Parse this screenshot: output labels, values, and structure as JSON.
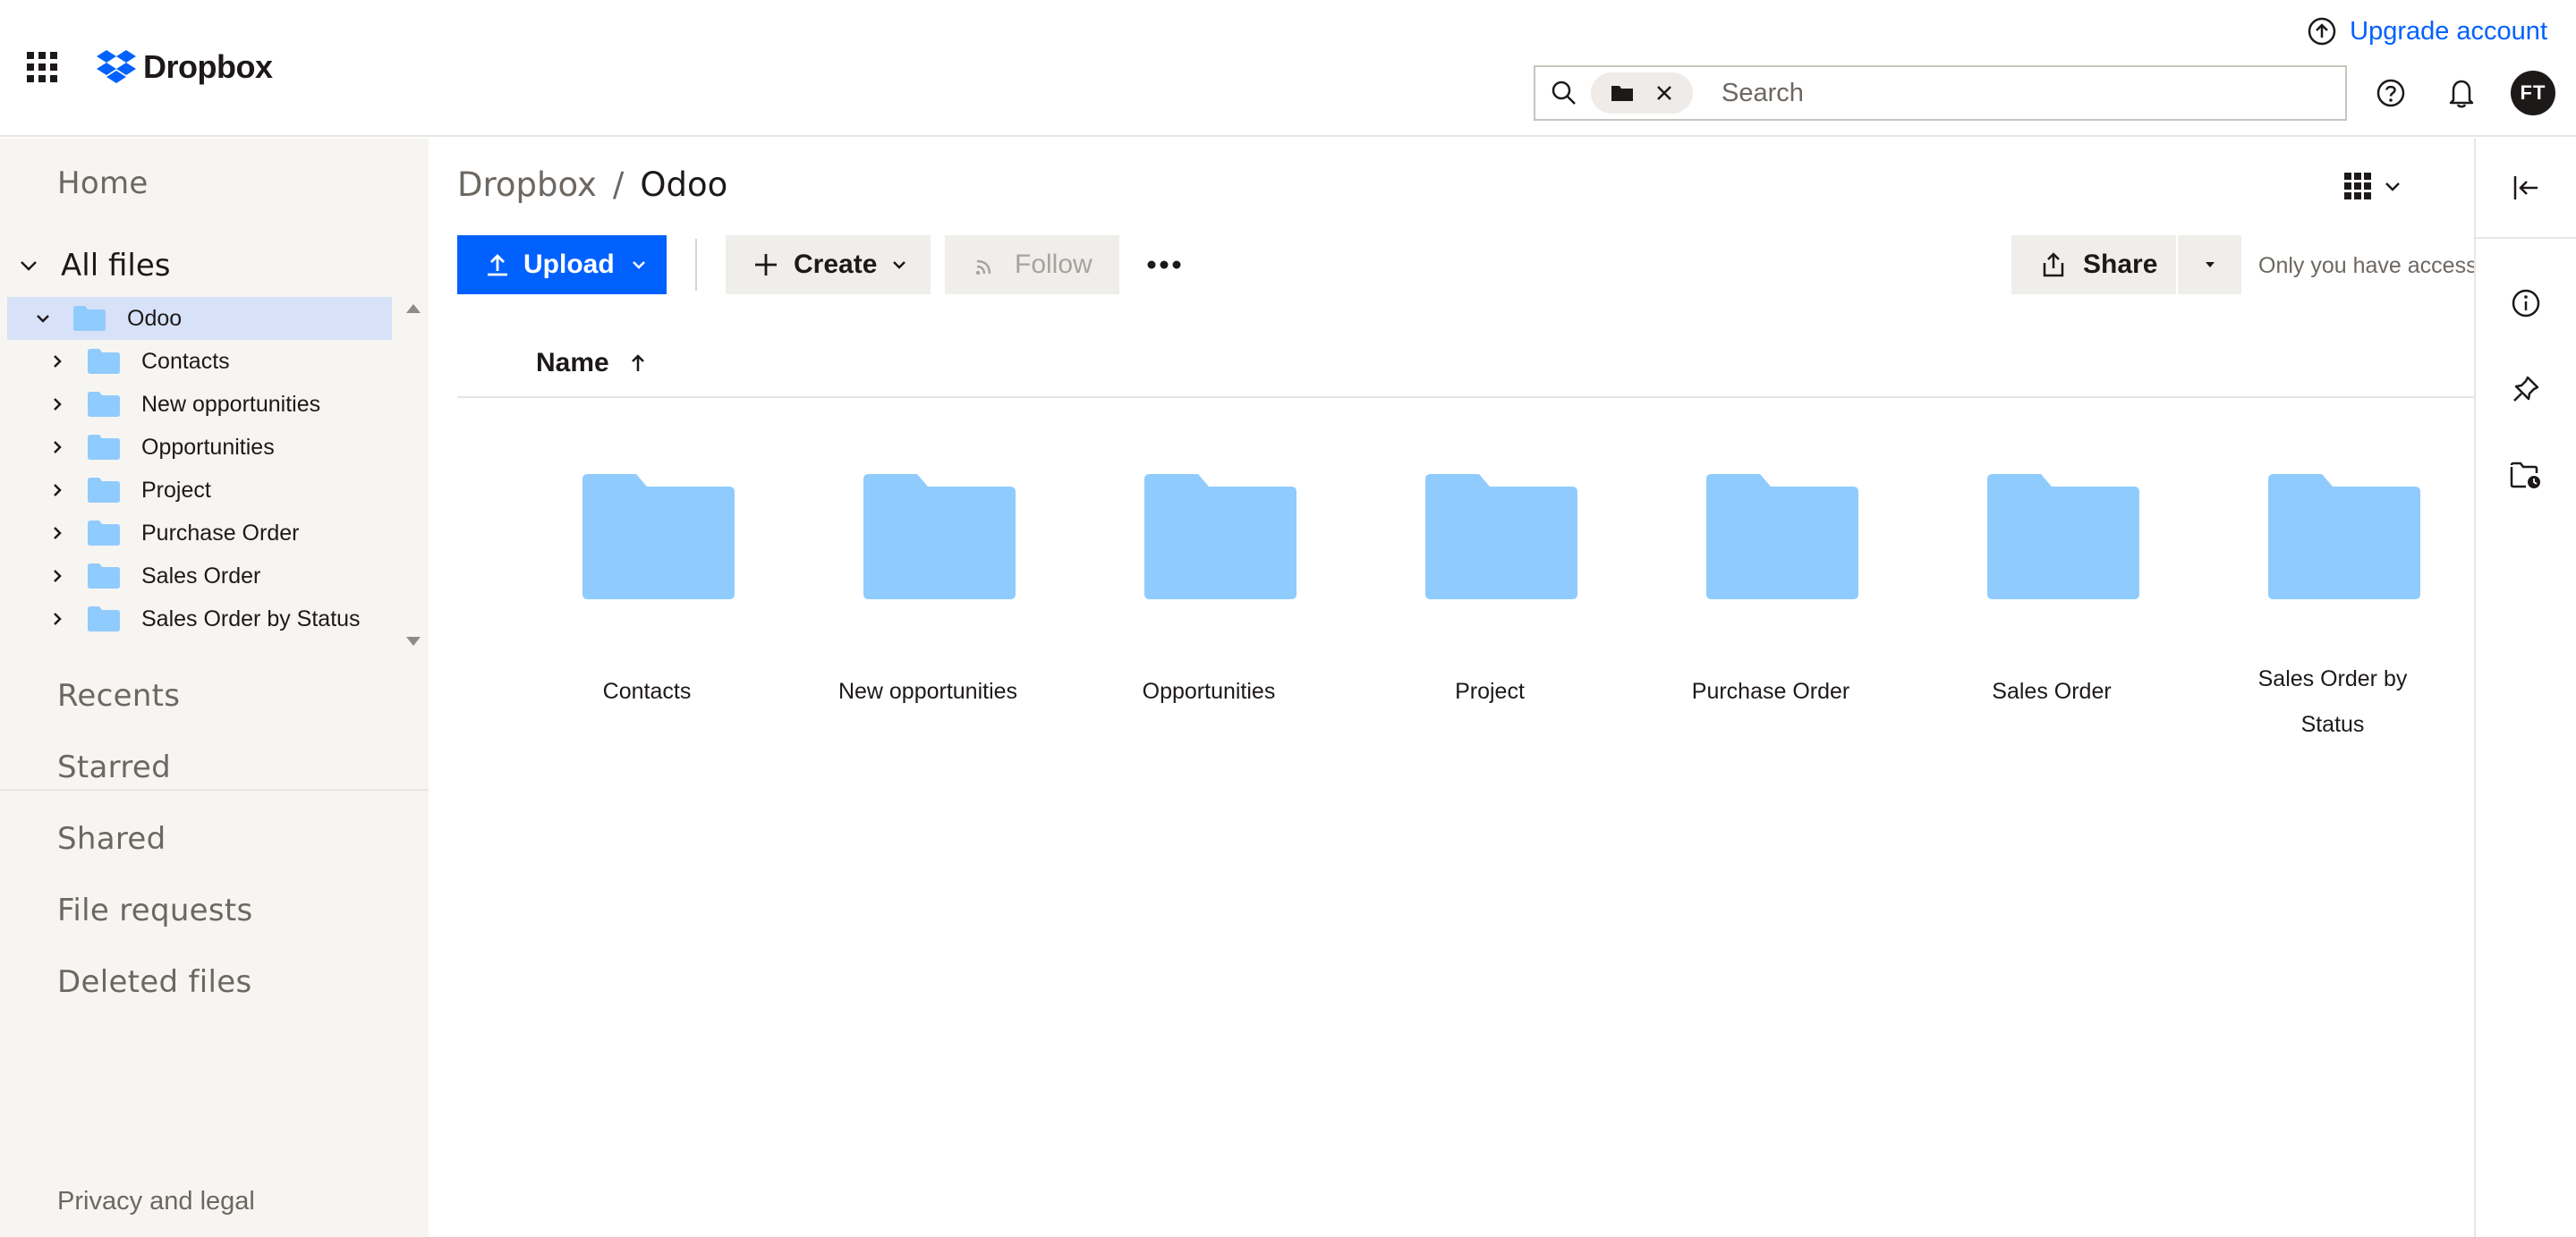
{
  "header": {
    "brand": "Dropbox",
    "upgrade_label": "Upgrade account",
    "search_placeholder": "Search",
    "avatar_initials": "FT"
  },
  "sidebar": {
    "home": "Home",
    "all_files": "All files",
    "tree": [
      {
        "label": "Odoo",
        "expanded": true,
        "selected": true
      },
      {
        "label": "Contacts"
      },
      {
        "label": "New opportunities"
      },
      {
        "label": "Opportunities"
      },
      {
        "label": "Project"
      },
      {
        "label": "Purchase Order"
      },
      {
        "label": "Sales Order"
      },
      {
        "label": "Sales Order by Status"
      }
    ],
    "recents": "Recents",
    "starred": "Starred",
    "shared": "Shared",
    "file_requests": "File requests",
    "deleted_files": "Deleted files",
    "privacy": "Privacy and legal"
  },
  "main": {
    "breadcrumb": {
      "root": "Dropbox",
      "separator": "/",
      "current": "Odoo"
    },
    "toolbar": {
      "upload": "Upload",
      "create": "Create",
      "follow": "Follow",
      "share": "Share",
      "access": "Only you have access"
    },
    "column_name": "Name",
    "folders": [
      "Contacts",
      "New opportunities",
      "Opportunities",
      "Project",
      "Purchase Order",
      "Sales Order",
      "Sales Order by Status"
    ]
  },
  "colors": {
    "accent": "#0061fe",
    "folder": "#90cbfd",
    "sidebar_bg": "#f7f5f2",
    "selected_row": "#d7e2f8"
  }
}
